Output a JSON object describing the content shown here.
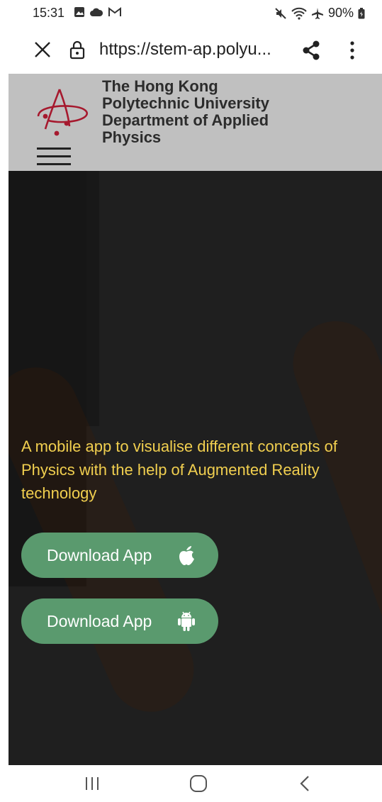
{
  "status_bar": {
    "time": "15:31",
    "battery": "90%",
    "notification_icons": [
      "image-icon",
      "cloud-icon",
      "gmail-icon"
    ],
    "system_icons": [
      "mute-icon",
      "wifi-icon",
      "airplane-icon",
      "battery-icon"
    ]
  },
  "browser": {
    "url": "https://stem-ap.polyu...",
    "close_icon": "close-icon",
    "lock_icon": "lock-icon",
    "share_icon": "share-icon",
    "menu_icon": "more-vert-icon"
  },
  "site_header": {
    "dept_lines": [
      "The Hong Kong",
      "Polytechnic University",
      "Department of Applied",
      "Physics"
    ],
    "background_color": "#c0c0c0",
    "logo_color": "#a6192e"
  },
  "hero": {
    "tagline": "A mobile app to visualise different concepts of Physics with the help of Augmented Reality technology",
    "tagline_color": "#f1cf4f",
    "buttons": [
      {
        "label": "Download App",
        "icon": "apple-icon"
      },
      {
        "label": "Download App",
        "icon": "android-icon"
      }
    ],
    "button_color": "#5a9a6e"
  },
  "nav_bar": {
    "icons": [
      "recent-apps-icon",
      "home-icon",
      "back-icon"
    ]
  }
}
